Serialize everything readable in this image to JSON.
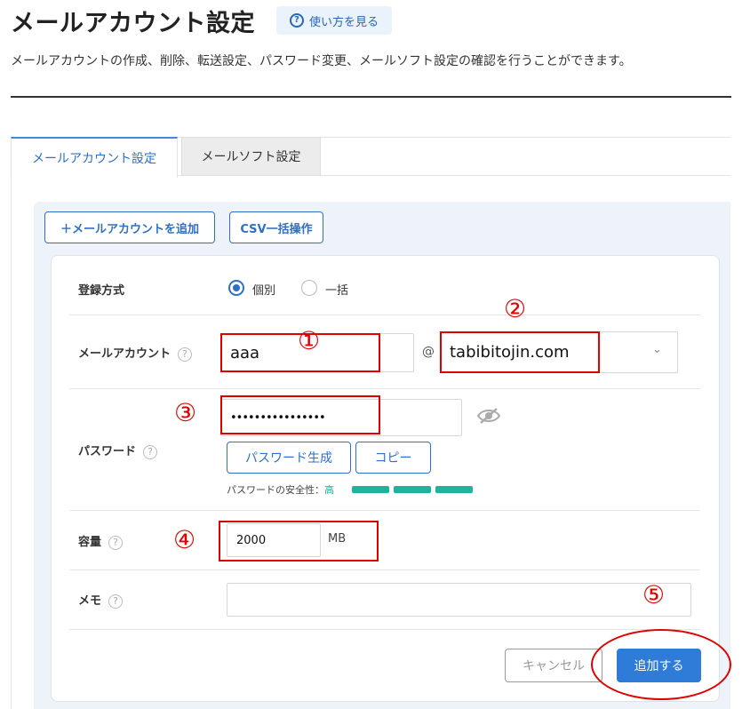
{
  "header": {
    "title": "メールアカウント設定",
    "help_label": "使い方を見る",
    "description": "メールアカウントの作成、削除、転送設定、パスワード変更、メールソフト設定の確認を行うことができます。"
  },
  "tabs": [
    {
      "label": "メールアカウント設定",
      "active": true
    },
    {
      "label": "メールソフト設定",
      "active": false
    }
  ],
  "toolbar": {
    "add_account_label": "＋メールアカウントを追加",
    "csv_label": "CSV一括操作"
  },
  "form": {
    "registration": {
      "label": "登録方式",
      "options": [
        "個別",
        "一括"
      ],
      "selected": "個別"
    },
    "mail_account": {
      "label": "メールアカウント",
      "local_part": "aaa",
      "at_sign": "@",
      "domain": "tabibitojin.com"
    },
    "password": {
      "label": "パスワード",
      "value": "••••••••••••••••",
      "generate_label": "パスワード生成",
      "copy_label": "コピー",
      "strength_label": "パスワードの安全性：",
      "strength_value": "高",
      "strength_fraction": 1.0
    },
    "capacity": {
      "label": "容量",
      "value": "2000",
      "unit": "MB"
    },
    "memo": {
      "label": "メモ",
      "value": ""
    },
    "help_icon_glyph": "?"
  },
  "actions": {
    "cancel_label": "キャンセル",
    "submit_label": "追加する"
  },
  "annotations": [
    "①",
    "②",
    "③",
    "④",
    "⑤"
  ],
  "colors": {
    "accent": "#2f7bd8",
    "annotation": "#e00000",
    "strength": "#20b29b"
  }
}
